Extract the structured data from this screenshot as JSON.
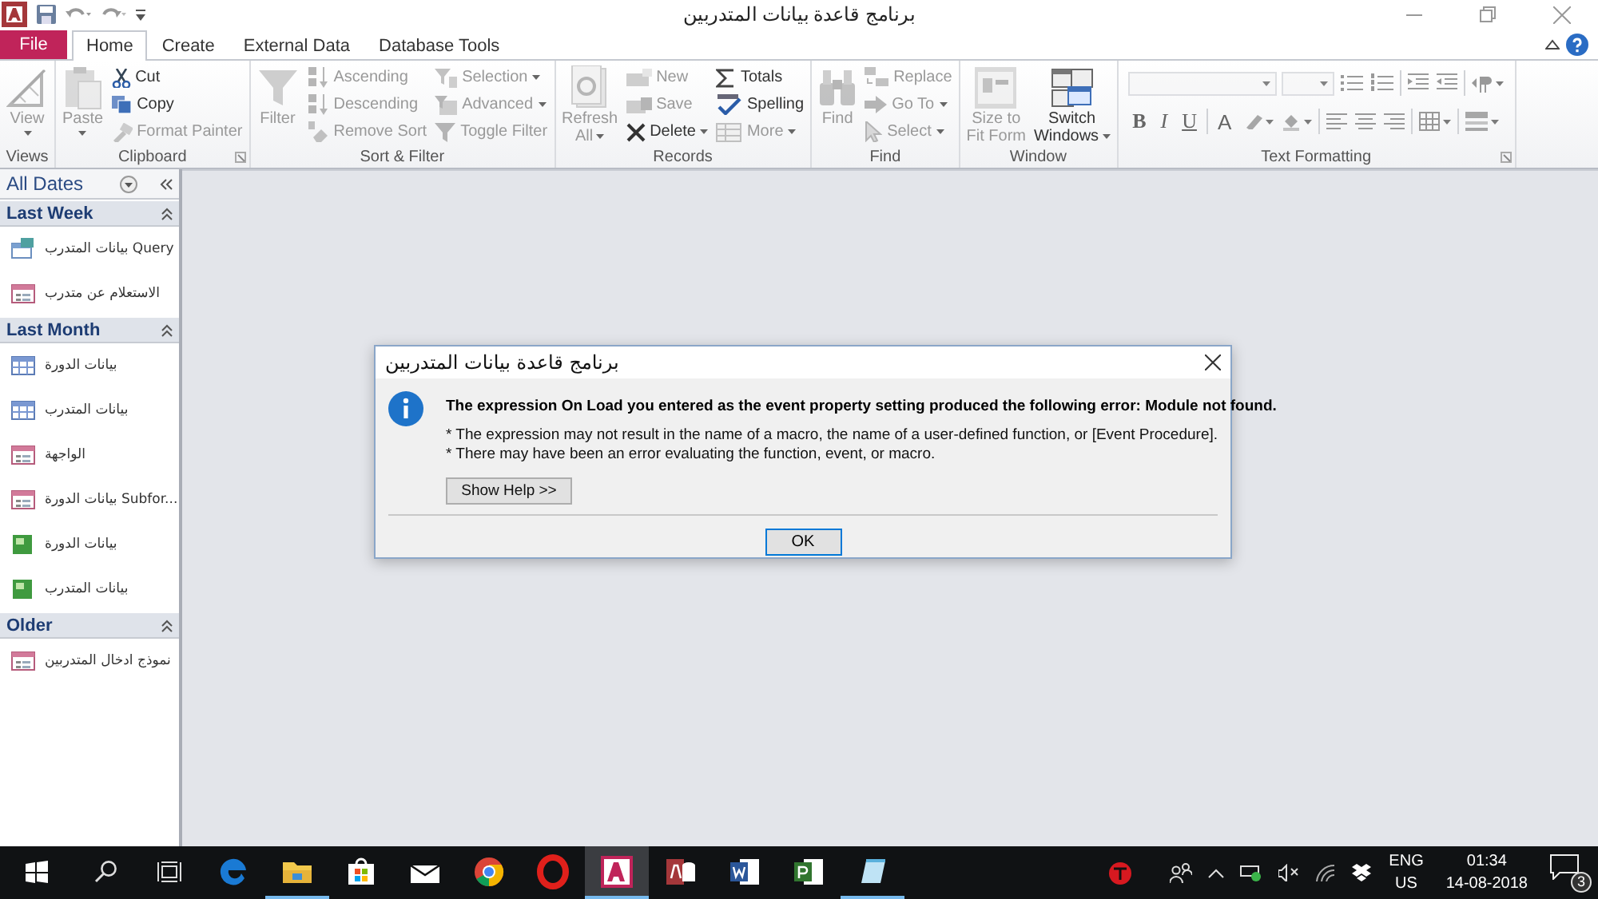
{
  "window": {
    "title": "برنامج قاعدة بيانات المتدربين"
  },
  "ribbon": {
    "tabs": [
      {
        "label": "File",
        "kind": "file",
        "selected": false
      },
      {
        "label": "Home",
        "kind": "tab",
        "selected": true
      },
      {
        "label": "Create",
        "kind": "tab",
        "selected": false
      },
      {
        "label": "External Data",
        "kind": "tab",
        "selected": false
      },
      {
        "label": "Database Tools",
        "kind": "tab",
        "selected": false
      }
    ],
    "groups": [
      {
        "label": "Views",
        "columns": [
          [
            {
              "label": "View",
              "kind": "large",
              "disabled": true,
              "dropdown": true
            }
          ]
        ]
      },
      {
        "label": "Clipboard",
        "launcher": true,
        "columns": [
          [
            {
              "label": "Paste",
              "kind": "large",
              "disabled": true,
              "dropdown": true
            }
          ],
          [
            {
              "label": "Cut",
              "kind": "small",
              "disabled": false,
              "dropdown": false
            },
            {
              "label": "Copy",
              "kind": "small",
              "disabled": false,
              "dropdown": false
            },
            {
              "label": "Format Painter",
              "kind": "small",
              "disabled": true,
              "dropdown": false
            }
          ]
        ]
      },
      {
        "label": "Sort & Filter",
        "columns": [
          [
            {
              "label": "Filter",
              "kind": "large",
              "disabled": true,
              "dropdown": false
            }
          ],
          [
            {
              "label": "Ascending",
              "kind": "small",
              "disabled": true,
              "dropdown": false
            },
            {
              "label": "Descending",
              "kind": "small",
              "disabled": true,
              "dropdown": false
            },
            {
              "label": "Remove Sort",
              "kind": "small",
              "disabled": true,
              "dropdown": false
            }
          ],
          [
            {
              "label": "Selection",
              "kind": "small",
              "disabled": true,
              "dropdown": true
            },
            {
              "label": "Advanced",
              "kind": "small",
              "disabled": true,
              "dropdown": true
            },
            {
              "label": "Toggle Filter",
              "kind": "small",
              "disabled": true,
              "dropdown": false
            }
          ]
        ]
      },
      {
        "label": "Records",
        "columns": [
          [
            {
              "label": "Refresh All",
              "kind": "large",
              "disabled": true,
              "dropdown": true
            }
          ],
          [
            {
              "label": "New",
              "kind": "small",
              "disabled": true,
              "dropdown": false
            },
            {
              "label": "Save",
              "kind": "small",
              "disabled": true,
              "dropdown": false
            },
            {
              "label": "Delete",
              "kind": "small",
              "disabled": false,
              "dropdown": true
            }
          ],
          [
            {
              "label": "Totals",
              "kind": "small",
              "disabled": false,
              "dropdown": false
            },
            {
              "label": "Spelling",
              "kind": "small",
              "disabled": false,
              "dropdown": false
            },
            {
              "label": "More",
              "kind": "small",
              "disabled": true,
              "dropdown": true
            }
          ]
        ]
      },
      {
        "label": "Find",
        "columns": [
          [
            {
              "label": "Find",
              "kind": "large",
              "disabled": true,
              "dropdown": false
            }
          ],
          [
            {
              "label": "Replace",
              "kind": "small",
              "disabled": true,
              "dropdown": false
            },
            {
              "label": "Go To",
              "kind": "small",
              "disabled": true,
              "dropdown": true
            },
            {
              "label": "Select",
              "kind": "small",
              "disabled": true,
              "dropdown": true
            }
          ]
        ]
      },
      {
        "label": "Window",
        "columns": [
          [
            {
              "label": "Size to Fit Form",
              "kind": "large",
              "disabled": true,
              "dropdown": false
            }
          ],
          [
            {
              "label": "Switch Windows",
              "kind": "large",
              "disabled": false,
              "dropdown": true
            }
          ]
        ]
      },
      {
        "label": "Text Formatting",
        "launcher": true,
        "rows": [
          [
            {
              "kind": "combo",
              "disabled": true
            },
            {
              "kind": "combo-small",
              "disabled": true
            },
            {
              "kind": "bullets",
              "disabled": true
            },
            {
              "kind": "numbering",
              "disabled": true
            },
            {
              "kind": "indent",
              "disabled": true
            },
            {
              "kind": "outdent",
              "disabled": true
            },
            {
              "kind": "paragraph",
              "disabled": true
            }
          ],
          [
            {
              "kind": "glyph",
              "label": "B",
              "disabled": true
            },
            {
              "kind": "glyph",
              "label": "I",
              "disabled": true
            },
            {
              "kind": "glyph",
              "label": "U",
              "disabled": true
            },
            {
              "kind": "glyph",
              "label": "A",
              "disabled": true
            },
            {
              "kind": "highlight",
              "disabled": true
            },
            {
              "kind": "fill",
              "disabled": true
            },
            {
              "kind": "align-left",
              "disabled": true
            },
            {
              "kind": "align-center",
              "disabled": true
            },
            {
              "kind": "align-right",
              "disabled": true
            },
            {
              "kind": "gridlines",
              "disabled": true
            },
            {
              "kind": "alt-row",
              "disabled": true
            }
          ]
        ]
      }
    ]
  },
  "nav_pane": {
    "title": "All Dates",
    "sections": [
      {
        "title": "Last Week",
        "expanded": true,
        "items": [
          {
            "label": "بيانات المتدرب Query",
            "kind": "query"
          },
          {
            "label": "الاستعلام عن متدرب",
            "kind": "form"
          }
        ]
      },
      {
        "title": "Last Month",
        "expanded": true,
        "items": [
          {
            "label": "بيانات الدورة",
            "kind": "table"
          },
          {
            "label": "بيانات المتدرب",
            "kind": "table"
          },
          {
            "label": "الواجهة",
            "kind": "form"
          },
          {
            "label": "بيانات الدورة Subfor...",
            "kind": "form"
          },
          {
            "label": "بيانات الدورة",
            "kind": "report"
          },
          {
            "label": "بيانات المتدرب",
            "kind": "report"
          }
        ]
      },
      {
        "title": "Older",
        "expanded": true,
        "items": [
          {
            "label": "نموذج ادخال المتدربين",
            "kind": "form"
          }
        ]
      }
    ]
  },
  "dialog": {
    "title": "برنامج قاعدة بيانات المتدربين",
    "heading": "The expression On Load you entered as the event property setting produced the following error: Module not found.",
    "details": [
      "* The expression may not result in the name of a macro, the name of a user-defined function, or [Event Procedure].",
      "* There may have been an error evaluating the function, event, or macro."
    ],
    "help_button": "Show Help >>",
    "ok_button": "OK"
  },
  "taskbar": {
    "apps": [
      {
        "kind": "edge",
        "active": false,
        "running": false
      },
      {
        "kind": "explorer",
        "active": false,
        "running": true
      },
      {
        "kind": "store",
        "active": false,
        "running": false
      },
      {
        "kind": "mail",
        "active": false,
        "running": false
      },
      {
        "kind": "chrome",
        "active": false,
        "running": false
      },
      {
        "kind": "opera",
        "active": false,
        "running": false
      },
      {
        "kind": "access-app",
        "active": true,
        "running": true
      },
      {
        "kind": "access",
        "active": false,
        "running": false
      },
      {
        "kind": "word",
        "active": false,
        "running": false
      },
      {
        "kind": "project",
        "active": false,
        "running": false
      },
      {
        "kind": "notepad",
        "active": false,
        "running": true
      }
    ],
    "language": "ENG",
    "region": "US",
    "time": "01:34",
    "date": "14-08-2018",
    "notifications": "3"
  }
}
